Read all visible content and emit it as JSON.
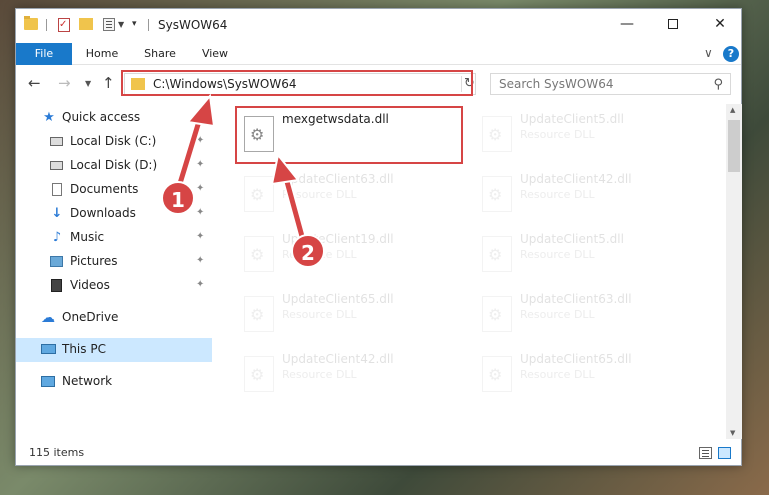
{
  "window": {
    "title": "SysWOW64",
    "min_label": "—",
    "close_label": "✕"
  },
  "ribbon": {
    "tabs": [
      {
        "label": "File"
      },
      {
        "label": "Home"
      },
      {
        "label": "Share"
      },
      {
        "label": "View"
      }
    ],
    "help_label": "?",
    "chevron_label": "∨"
  },
  "nav": {
    "back_label": "←",
    "forward_label": "→",
    "dropdown_label": "▼",
    "up_label": "↑",
    "address": "C:\\Windows\\SysWOW64",
    "refresh_label": "↻",
    "search_placeholder": "Search SysWOW64",
    "search_glyph": "⚲"
  },
  "sidebar": {
    "items": [
      {
        "label": "Quick access",
        "icon": "star-icon"
      },
      {
        "label": "Local Disk (C:)",
        "icon": "drive-icon",
        "pinned": true
      },
      {
        "label": "Local Disk (D:)",
        "icon": "drive-icon",
        "pinned": true
      },
      {
        "label": "Documents",
        "icon": "document-icon",
        "pinned": true
      },
      {
        "label": "Downloads",
        "icon": "download-icon",
        "pinned": true
      },
      {
        "label": "Music",
        "icon": "music-icon",
        "pinned": true
      },
      {
        "label": "Pictures",
        "icon": "picture-icon",
        "pinned": true
      },
      {
        "label": "Videos",
        "icon": "video-icon",
        "pinned": true
      },
      {
        "label": "OneDrive",
        "icon": "cloud-icon"
      },
      {
        "label": "This PC",
        "icon": "computer-icon",
        "selected": true
      },
      {
        "label": "Network",
        "icon": "network-icon"
      }
    ],
    "pin_glyph": "📌"
  },
  "files": [
    {
      "name": "mexgetwsdata.dll",
      "type": "",
      "highlighted": true
    },
    {
      "name": "UpdateClient5.dll",
      "type": "Resource DLL"
    },
    {
      "name": "UpdateClient63.dll",
      "type": "Resource DLL"
    },
    {
      "name": "UpdateClient42.dll",
      "type": "Resource DLL"
    },
    {
      "name": "UpdateClient19.dll",
      "type": "Resource DLL"
    },
    {
      "name": "UpdateClient5.dll",
      "type": "Resource DLL"
    },
    {
      "name": "UpdateClient65.dll",
      "type": "Resource DLL"
    },
    {
      "name": "UpdateClient63.dll",
      "type": "Resource DLL"
    },
    {
      "name": "UpdateClient42.dll",
      "type": "Resource DLL"
    },
    {
      "name": "UpdateClient65.dll",
      "type": "Resource DLL"
    }
  ],
  "status": {
    "item_count": "115 items"
  },
  "annotations": {
    "step1": "1",
    "step2": "2",
    "color": "#d64545"
  }
}
